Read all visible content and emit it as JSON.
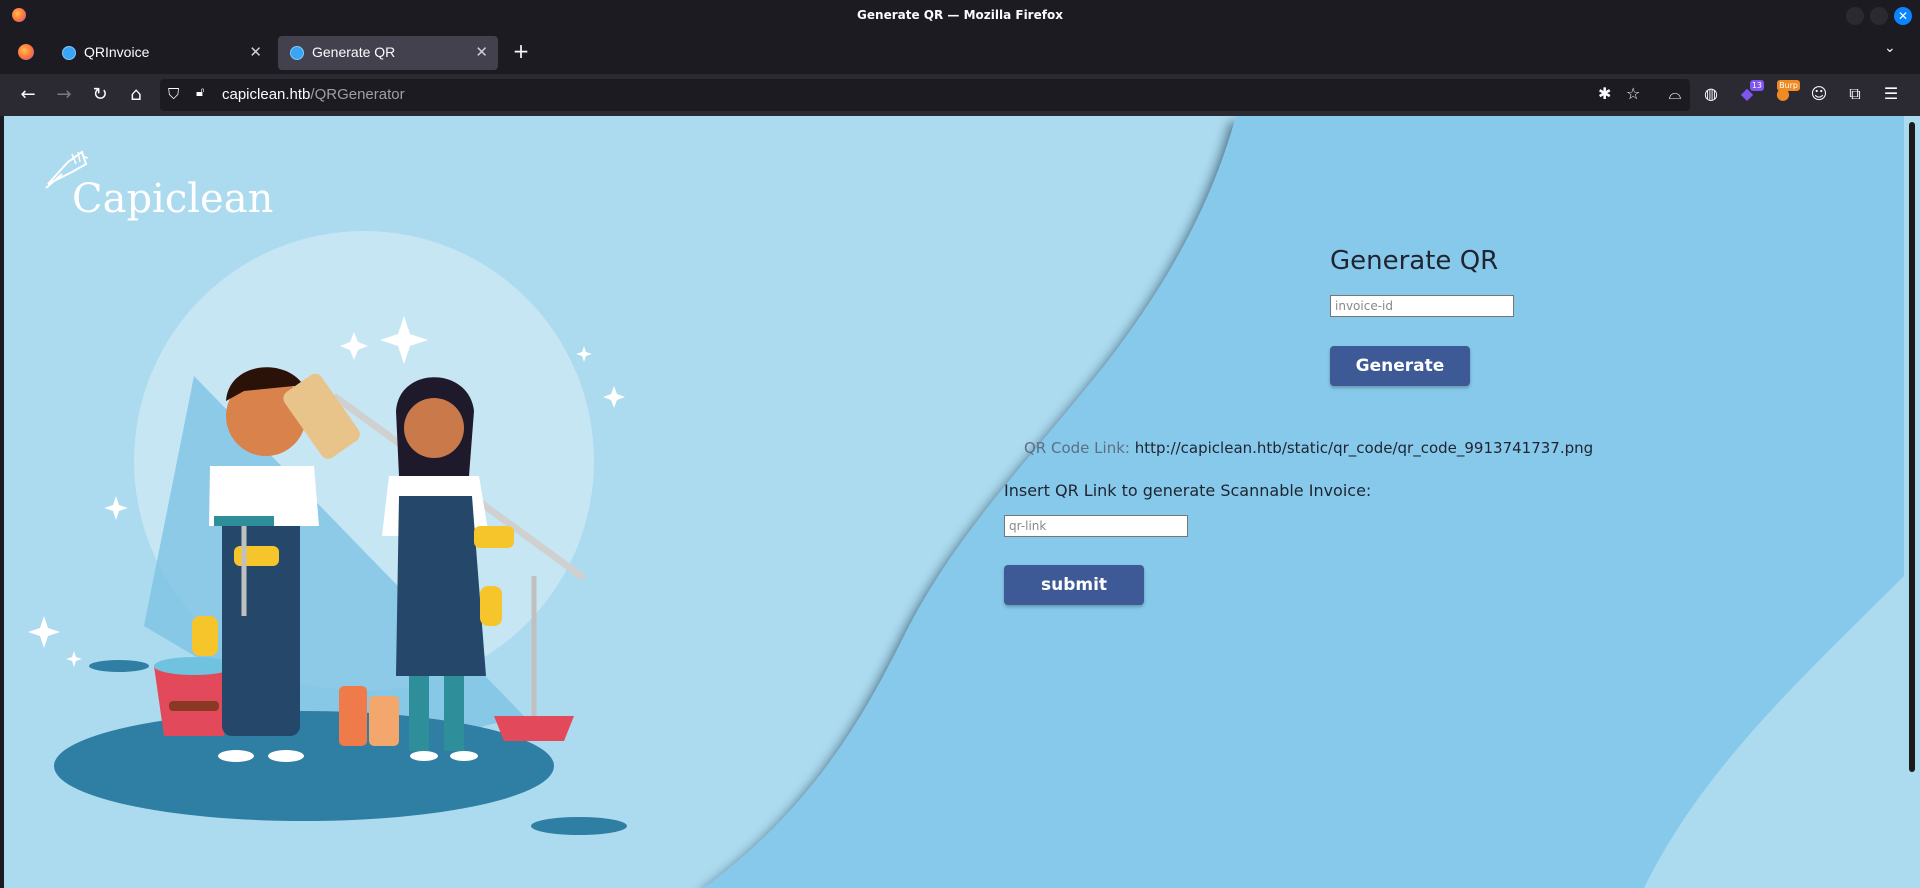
{
  "window": {
    "title": "Generate QR — Mozilla Firefox"
  },
  "tabs": [
    {
      "label": "QRInvoice",
      "active": false
    },
    {
      "label": "Generate QR",
      "active": true
    }
  ],
  "urlbar": {
    "host": "capiclean.htb",
    "path": "/QRGenerator"
  },
  "extensions": {
    "badge_count": "13",
    "burp_label": "Burp"
  },
  "logo": {
    "brand": "Capiclean"
  },
  "form": {
    "title": "Generate QR",
    "invoice_placeholder": "invoice-id",
    "generate_label": "Generate",
    "qr_link_label": "QR Code Link:",
    "qr_link_value": "http://capiclean.htb/static/qr_code/qr_code_9913741737.png",
    "insert_label": "Insert QR Link to generate Scannable Invoice:",
    "qr_link_placeholder": "qr-link",
    "submit_label": "submit"
  },
  "colors": {
    "page_light": "#acdaee",
    "page_dark": "#87c9ea",
    "button": "#3d5a96",
    "browser_chrome": "#1c1b22",
    "toolbar": "#2b2a33"
  }
}
